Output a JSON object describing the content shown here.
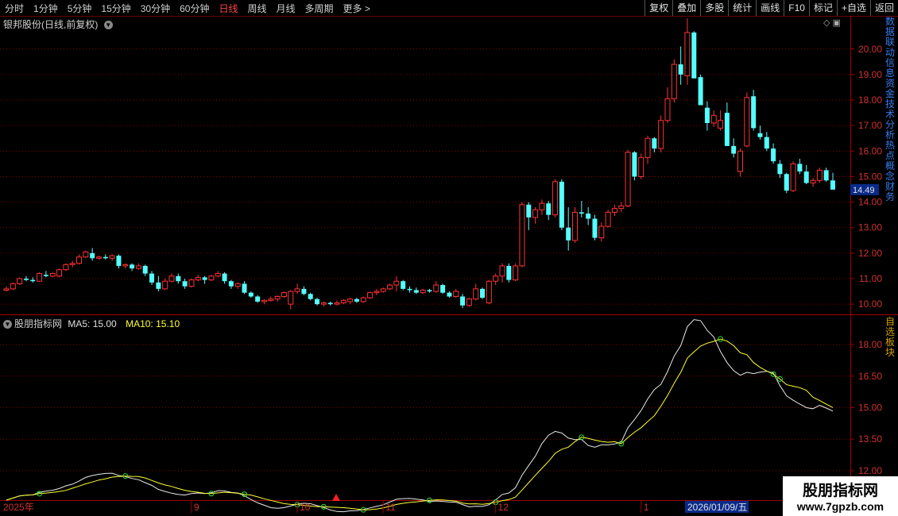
{
  "toolbar": {
    "periods": [
      "分时",
      "1分钟",
      "5分钟",
      "15分钟",
      "30分钟",
      "60分钟",
      "日线",
      "周线",
      "月线",
      "多周期",
      "更多 >"
    ],
    "active_period": "日线",
    "tools": [
      "复权",
      "叠加",
      "多股",
      "统计",
      "画线",
      "F10",
      "标记",
      "+自选",
      "返回"
    ]
  },
  "stock_title": "银邦股份(日线,前复权)",
  "price_tag": "14.49",
  "indicator": {
    "name": "股朋指标网",
    "ma5_label": "MA5: 15.00",
    "ma10_label": "MA10: 15.10"
  },
  "date_axis": {
    "year_label": "2025年",
    "month_labels": [
      "9",
      "10",
      "11",
      "12",
      "1"
    ],
    "cursor_date": "2026/01/09/五"
  },
  "side_text": "数据联动信息资金技术分析热点概念财务",
  "side_text2": "自选板块",
  "watermark": {
    "line1": "股朋指标网",
    "line2": "www.7gpzb.com"
  },
  "colors": {
    "up": "#ff3232",
    "down": "#54ffff",
    "ma5": "#e8e8e8",
    "ma10": "#ffff33",
    "grid": "#8a0000"
  },
  "chart_data": [
    {
      "type": "candlestick",
      "title": "银邦股份(日线,前复权)",
      "y_ticks": [
        10.0,
        11.0,
        12.0,
        13.0,
        14.0,
        15.0,
        16.0,
        17.0,
        18.0,
        19.0,
        20.0
      ],
      "ylim": [
        9.6,
        21.3
      ],
      "candles": [
        [
          10.55,
          10.7,
          10.5,
          10.6
        ],
        [
          10.6,
          10.85,
          10.55,
          10.8
        ],
        [
          10.8,
          11.05,
          10.75,
          11.0
        ],
        [
          11.0,
          11.1,
          10.9,
          10.95
        ],
        [
          10.95,
          11.05,
          10.85,
          10.9
        ],
        [
          10.9,
          11.25,
          10.88,
          11.2
        ],
        [
          11.15,
          11.3,
          11.05,
          11.1
        ],
        [
          11.1,
          11.25,
          11.05,
          11.2
        ],
        [
          11.1,
          11.4,
          11.05,
          11.35
        ],
        [
          11.35,
          11.6,
          11.3,
          11.55
        ],
        [
          11.55,
          11.7,
          11.45,
          11.6
        ],
        [
          11.6,
          11.95,
          11.55,
          11.85
        ],
        [
          11.85,
          12.1,
          11.8,
          12.05
        ],
        [
          12.0,
          12.2,
          11.7,
          11.8
        ],
        [
          11.8,
          11.9,
          11.75,
          11.85
        ],
        [
          11.85,
          11.95,
          11.75,
          11.8
        ],
        [
          11.8,
          11.95,
          11.7,
          11.9
        ],
        [
          11.9,
          11.95,
          11.4,
          11.5
        ],
        [
          11.5,
          11.6,
          11.4,
          11.55
        ],
        [
          11.55,
          11.6,
          11.3,
          11.4
        ],
        [
          11.4,
          11.6,
          11.35,
          11.5
        ],
        [
          11.5,
          11.55,
          11.1,
          11.2
        ],
        [
          11.2,
          11.3,
          10.75,
          10.85
        ],
        [
          10.85,
          11.1,
          10.5,
          10.6
        ],
        [
          10.6,
          11.0,
          10.55,
          10.9
        ],
        [
          10.9,
          11.2,
          10.85,
          11.1
        ],
        [
          11.1,
          11.2,
          10.8,
          10.9
        ],
        [
          10.9,
          11.0,
          10.6,
          10.7
        ],
        [
          10.7,
          11.0,
          10.65,
          10.95
        ],
        [
          10.95,
          11.15,
          10.9,
          11.05
        ],
        [
          11.05,
          11.1,
          10.8,
          10.95
        ],
        [
          10.95,
          11.15,
          10.9,
          11.1
        ],
        [
          11.1,
          11.3,
          11.05,
          11.2
        ],
        [
          11.2,
          11.25,
          10.8,
          10.9
        ],
        [
          10.9,
          10.95,
          10.6,
          10.7
        ],
        [
          10.7,
          10.85,
          10.6,
          10.8
        ],
        [
          10.8,
          10.9,
          10.4,
          10.45
        ],
        [
          10.45,
          10.5,
          10.25,
          10.3
        ],
        [
          10.3,
          10.35,
          10.05,
          10.1
        ],
        [
          10.1,
          10.2,
          10.0,
          10.15
        ],
        [
          10.15,
          10.3,
          10.1,
          10.2
        ],
        [
          10.2,
          10.35,
          10.1,
          10.3
        ],
        [
          10.3,
          10.5,
          10.25,
          10.45
        ],
        [
          10.0,
          10.55,
          9.8,
          10.5
        ],
        [
          10.5,
          10.8,
          10.4,
          10.6
        ],
        [
          10.6,
          10.7,
          10.35,
          10.4
        ],
        [
          10.4,
          10.45,
          10.15,
          10.2
        ],
        [
          10.2,
          10.25,
          9.95,
          10.0
        ],
        [
          10.0,
          10.1,
          9.9,
          10.05
        ],
        [
          10.05,
          10.1,
          9.95,
          10.0
        ],
        [
          10.0,
          10.15,
          9.95,
          10.05
        ],
        [
          10.05,
          10.2,
          10.0,
          10.15
        ],
        [
          10.1,
          10.25,
          10.0,
          10.2
        ],
        [
          10.2,
          10.25,
          10.05,
          10.1
        ],
        [
          10.1,
          10.3,
          10.05,
          10.25
        ],
        [
          10.25,
          10.5,
          10.2,
          10.45
        ],
        [
          10.45,
          10.6,
          10.35,
          10.5
        ],
        [
          10.5,
          10.65,
          10.45,
          10.6
        ],
        [
          10.6,
          10.8,
          10.55,
          10.75
        ],
        [
          10.75,
          11.1,
          10.5,
          10.9
        ],
        [
          10.9,
          10.95,
          10.55,
          10.6
        ],
        [
          10.6,
          10.7,
          10.45,
          10.55
        ],
        [
          10.55,
          10.65,
          10.4,
          10.45
        ],
        [
          10.45,
          10.6,
          10.4,
          10.55
        ],
        [
          10.55,
          10.6,
          10.45,
          10.5
        ],
        [
          10.5,
          10.9,
          10.45,
          10.75
        ],
        [
          10.75,
          10.8,
          10.4,
          10.45
        ],
        [
          10.45,
          10.5,
          10.25,
          10.3
        ],
        [
          10.3,
          10.6,
          10.25,
          10.5
        ],
        [
          10.3,
          10.4,
          9.85,
          9.95
        ],
        [
          9.95,
          10.25,
          9.9,
          10.2
        ],
        [
          10.2,
          10.8,
          10.15,
          10.6
        ],
        [
          10.6,
          10.65,
          10.2,
          10.25
        ],
        [
          10.05,
          10.95,
          10.0,
          10.9
        ],
        [
          10.9,
          11.2,
          10.75,
          11.1
        ],
        [
          11.1,
          11.6,
          10.85,
          11.5
        ],
        [
          11.5,
          11.6,
          10.85,
          10.95
        ],
        [
          10.95,
          11.6,
          10.9,
          11.5
        ],
        [
          11.5,
          14.0,
          11.45,
          13.9
        ],
        [
          13.9,
          14.0,
          12.9,
          13.4
        ],
        [
          13.4,
          13.8,
          13.15,
          13.7
        ],
        [
          13.7,
          14.1,
          13.5,
          13.95
        ],
        [
          13.95,
          14.05,
          13.3,
          13.5
        ],
        [
          13.5,
          14.9,
          13.4,
          14.8
        ],
        [
          14.8,
          14.9,
          12.9,
          13.0
        ],
        [
          13.0,
          13.8,
          12.1,
          12.5
        ],
        [
          12.5,
          13.8,
          12.4,
          13.6
        ],
        [
          13.6,
          14.05,
          13.4,
          13.55
        ],
        [
          13.55,
          13.8,
          13.1,
          13.35
        ],
        [
          13.35,
          13.5,
          12.5,
          12.6
        ],
        [
          12.6,
          13.2,
          12.45,
          13.05
        ],
        [
          13.05,
          13.7,
          13.0,
          13.6
        ],
        [
          13.6,
          13.9,
          13.45,
          13.75
        ],
        [
          13.75,
          14.0,
          13.6,
          13.85
        ],
        [
          13.85,
          16.05,
          13.8,
          15.95
        ],
        [
          15.95,
          16.0,
          14.85,
          15.0
        ],
        [
          15.0,
          15.9,
          14.9,
          15.75
        ],
        [
          15.75,
          16.6,
          15.5,
          16.5
        ],
        [
          16.5,
          16.55,
          15.95,
          16.1
        ],
        [
          16.1,
          17.4,
          15.95,
          17.2
        ],
        [
          17.2,
          18.5,
          17.1,
          18.05
        ],
        [
          18.05,
          19.6,
          17.9,
          19.4
        ],
        [
          19.4,
          20.1,
          18.6,
          19.0
        ],
        [
          18.95,
          21.2,
          18.6,
          20.65
        ],
        [
          20.65,
          20.7,
          19.05,
          18.85
        ],
        [
          18.9,
          19.0,
          17.85,
          17.8
        ],
        [
          17.7,
          17.95,
          16.8,
          17.1
        ],
        [
          17.1,
          17.6,
          16.95,
          17.4
        ],
        [
          16.9,
          17.6,
          16.8,
          17.2
        ],
        [
          17.5,
          17.9,
          16.2,
          16.2
        ],
        [
          16.2,
          16.5,
          15.75,
          15.9
        ],
        [
          15.2,
          16.1,
          15.0,
          16.0
        ],
        [
          16.2,
          18.3,
          16.15,
          18.1
        ],
        [
          18.15,
          18.4,
          16.8,
          16.9
        ],
        [
          16.7,
          17.0,
          16.45,
          16.55
        ],
        [
          16.55,
          16.75,
          16.0,
          16.1
        ],
        [
          16.1,
          16.3,
          15.5,
          15.6
        ],
        [
          15.5,
          15.65,
          14.95,
          15.1
        ],
        [
          15.1,
          15.15,
          14.35,
          14.45
        ],
        [
          14.45,
          15.6,
          14.4,
          15.5
        ],
        [
          15.5,
          15.7,
          15.1,
          15.2
        ],
        [
          15.2,
          15.45,
          14.7,
          14.75
        ],
        [
          14.75,
          14.95,
          14.6,
          14.85
        ],
        [
          14.85,
          15.35,
          14.75,
          15.25
        ],
        [
          15.25,
          15.35,
          14.8,
          14.85
        ],
        [
          14.85,
          15.15,
          14.6,
          14.49
        ]
      ]
    },
    {
      "type": "line",
      "title": "股朋指标网",
      "y_ticks": [
        12.0,
        13.5,
        15.0,
        16.5,
        18.0
      ],
      "ylim": [
        10.6,
        19.4
      ],
      "series": [
        {
          "name": "MA5",
          "color": "#e8e8e8"
        },
        {
          "name": "MA10",
          "color": "#ffff33"
        }
      ]
    }
  ]
}
